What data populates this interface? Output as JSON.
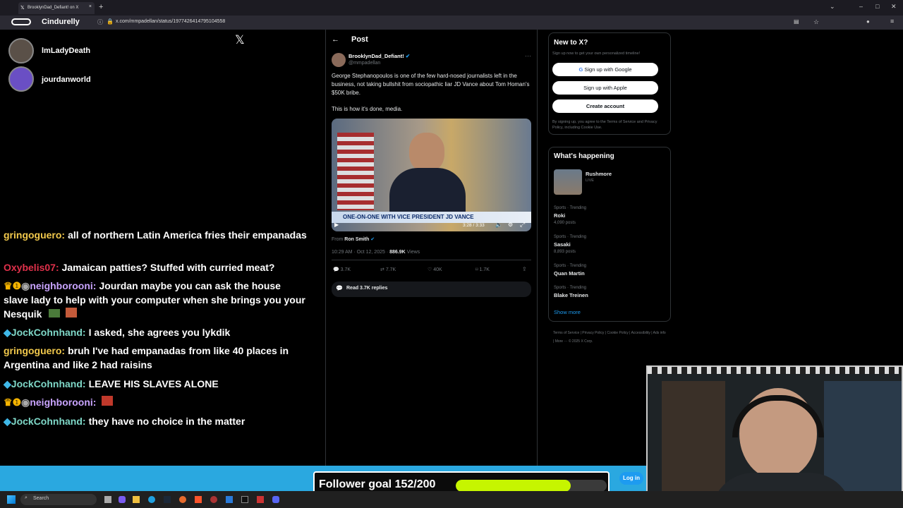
{
  "browser": {
    "tab_title": "BrooklynDad_Defiant! on X",
    "url": "x.com/mmpadellan/status/1977426414795104558",
    "brand": "Cindurelly"
  },
  "viewers": [
    {
      "name": "lmLadyDeath"
    },
    {
      "name": "jourdanworld"
    }
  ],
  "chat": [
    {
      "user": "gringoguero:",
      "color": "#f2c94c",
      "text": "all of northern Latin America fries their empanadas"
    },
    {
      "user": "Oxybelis07:",
      "color": "#e0314b",
      "text": "Jamaican patties? Stuffed with curried meat?"
    },
    {
      "user": "neighborooni:",
      "color": "#c9a4ff",
      "text": "Jourdan maybe you can ask the house slave lady to help with your computer when she brings you your Nesquik"
    },
    {
      "user": "JockCohnhand:",
      "color": "#7fd8c8",
      "text": "I asked, she agrees you lykdik"
    },
    {
      "user": "gringoguero:",
      "color": "#f2c94c",
      "text": "bruh I've had empanadas from like 40 places in Argentina and like 2 had raisins"
    },
    {
      "user": "JockCohnhand:",
      "color": "#7fd8c8",
      "text": "LEAVE HIS SLAVES ALONE"
    },
    {
      "user": "neighborooni:",
      "color": "#c9a4ff",
      "text": ""
    },
    {
      "user": "JockCohnhand:",
      "color": "#7fd8c8",
      "text": "they have no choice in the matter"
    }
  ],
  "post": {
    "header": "Post",
    "author": "BrooklynDad_Defiant!",
    "handle": "@mmpadellan",
    "body1": "George Stephanopoulos is one of the few hard-nosed journalists left in the business, not taking bullshit from sociopathic liar JD Vance about Tom Homan's $50K bribe.",
    "body2": "This is how it's done, media.",
    "video_banner": "ONE-ON-ONE WITH VICE PRESIDENT JD VANCE",
    "video_time": "3:28 / 3:33",
    "from_label": "From",
    "from_name": "Ron Smith",
    "timestamp": "10:29 AM · Oct 12, 2025 ·",
    "views": "886.9K",
    "views_label": "Views",
    "replies": "3.7K",
    "reposts": "7.7K",
    "likes": "40K",
    "bookmarks": "1.7K",
    "read_replies": "Read 3.7K replies"
  },
  "signup": {
    "title": "New to X?",
    "subtitle": "Sign up now to get your own personalized timeline!",
    "google": "Sign up with Google",
    "apple": "Sign up with Apple",
    "create": "Create account",
    "terms": "By signing up, you agree to the Terms of Service and Privacy Policy, including Cookie Use."
  },
  "happening": {
    "title": "What's happening",
    "live_name": "Rushmore",
    "live_tag": "LIVE",
    "trends": [
      {
        "cat": "Sports · Trending",
        "name": "Roki",
        "posts": "4,090 posts"
      },
      {
        "cat": "Sports · Trending",
        "name": "Sasaki",
        "posts": "8,893 posts"
      },
      {
        "cat": "Sports · Trending",
        "name": "Quan Martin",
        "posts": ""
      },
      {
        "cat": "Sports · Trending",
        "name": "Blake Treinen",
        "posts": ""
      }
    ],
    "show_more": "Show more",
    "footer": "Terms of Service | Privacy Policy | Cookie Policy | Accessibility | Ads info | More ··· © 2025 X Corp."
  },
  "goal": {
    "label": "Follower goal 152/200",
    "current": 152,
    "target": 200,
    "fill_color": "#c6f500"
  },
  "login": "Log in",
  "taskbar": {
    "search": "Search"
  }
}
